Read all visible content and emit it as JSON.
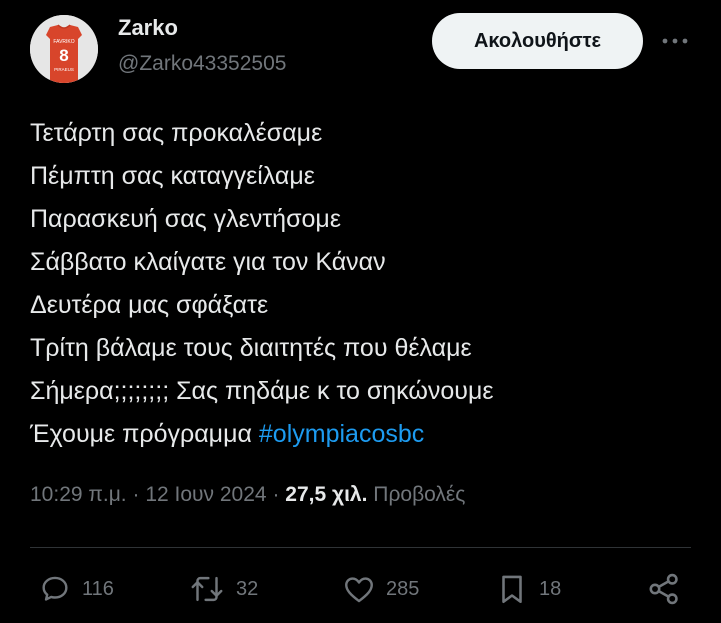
{
  "author": {
    "name": "Zarko",
    "handle": "@Zarko43352505",
    "avatar_jersey_number": "8"
  },
  "follow_label": "Ακολουθήστε",
  "tweet": {
    "lines": [
      "Τετάρτη σας προκαλέσαμε",
      "Πέμπτη σας καταγγείλαμε",
      "Παρασκευή σας γλεντήσομε",
      "Σάββατο κλαίγατε για τον Κάναν",
      "Δευτέρα μας σφάξατε",
      "Τρίτη βάλαμε τους διαιτητές που θέλαμε",
      "Σήμερα;;;;;;;; Σας πηδάμε κ το σηκώνουμε",
      "Έχουμε πρόγραμμα "
    ],
    "hashtag": "#olympiacosbc"
  },
  "meta": {
    "time": "10:29 π.μ.",
    "sep1": "·",
    "date": "12 Ιουν 2024",
    "sep2": "·",
    "views_count": "27,5 χιλ.",
    "views_label": "Προβολές"
  },
  "actions": {
    "replies": "116",
    "retweets": "32",
    "likes": "285",
    "bookmarks": "18"
  },
  "colors": {
    "background": "#000000",
    "text": "#e7e9ea",
    "muted": "#71767b",
    "link": "#1d9bf0",
    "button_bg": "#eff3f4",
    "divider": "#2f3336"
  }
}
